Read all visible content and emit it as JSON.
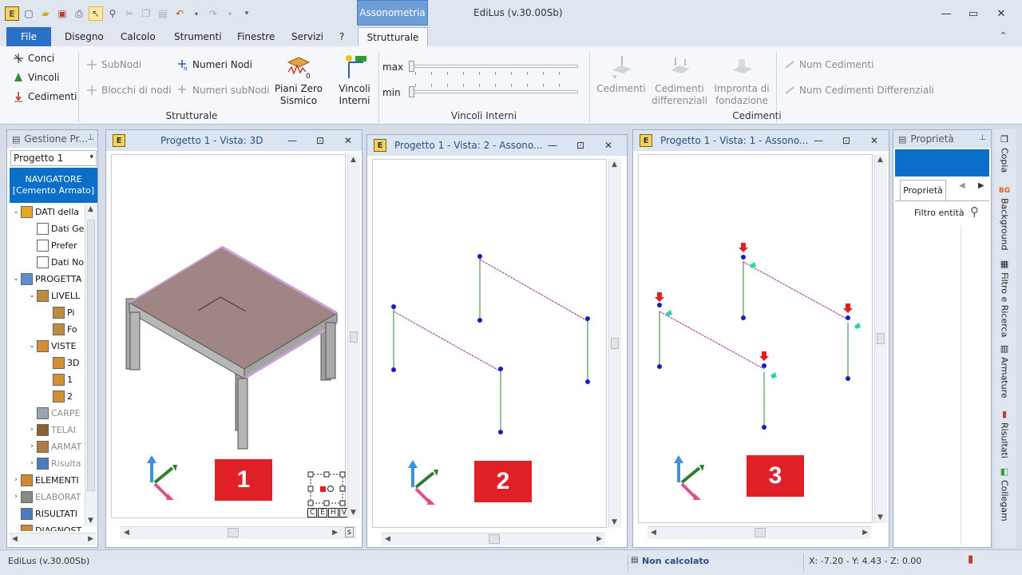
{
  "app": {
    "title": "EdiLus (v.30.00Sb)",
    "context_tab": "Assonometria"
  },
  "menu": {
    "file": "File",
    "tabs": [
      "Disegno",
      "Calcolo",
      "Strumenti",
      "Finestre",
      "Servizi",
      "?"
    ],
    "active_tab": "Strutturale"
  },
  "ribbon": {
    "strutturale": {
      "conci": "Conci",
      "vincoli": "Vincoli",
      "cedimenti": "Cedimenti",
      "subnodi": "SubNodi",
      "blocchi": "Blocchi di nodi",
      "numeri_nodi": "Numeri Nodi",
      "numeri_subnodi": "Numeri subNodi",
      "piani_zero": "Piani Zero Sismico",
      "group": "Strutturale"
    },
    "vincoli_interni": {
      "max": "max",
      "min": "min",
      "button": "Vincoli Interni",
      "group": "Vincoli Interni",
      "max_level": 0,
      "min_level": 0
    },
    "cedimenti": {
      "cedimenti": "Cedimenti",
      "differenziali": "Cedimenti differenziali",
      "impronta": "Impronta di fondazione",
      "num_ced": "Num Cedimenti",
      "num_ced_diff": "Num Cedimenti Differenziali",
      "group": "Cedimenti"
    }
  },
  "left_panel": {
    "title": "Gestione Pr...",
    "dropdown": "Progetto 1",
    "navigator_line1": "NAVIGATORE",
    "navigator_line2": "[Cemento Armato]",
    "tree": [
      {
        "label": "DATI della",
        "exp": "v",
        "indent": 0,
        "icon": "folder-icon",
        "dis": false
      },
      {
        "label": "Dati Ge",
        "exp": "",
        "indent": 1,
        "icon": "doc-icon",
        "dis": false
      },
      {
        "label": "Prefer",
        "exp": "",
        "indent": 1,
        "icon": "doc-icon",
        "dis": false
      },
      {
        "label": "Dati No",
        "exp": "",
        "indent": 1,
        "icon": "doc-icon",
        "dis": false
      },
      {
        "label": "PROGETTA",
        "exp": "v",
        "indent": 0,
        "icon": "project-icon",
        "dis": false
      },
      {
        "label": "LIVELL",
        "exp": "v",
        "indent": 1,
        "icon": "levels-icon",
        "dis": false
      },
      {
        "label": "Pi",
        "exp": "",
        "indent": 2,
        "icon": "level-icon",
        "dis": false
      },
      {
        "label": "Fo",
        "exp": "",
        "indent": 2,
        "icon": "level-icon",
        "dis": false
      },
      {
        "label": "VISTE",
        "exp": "v",
        "indent": 1,
        "icon": "3d-icon",
        "dis": false
      },
      {
        "label": "3D",
        "exp": "",
        "indent": 2,
        "icon": "3d-icon",
        "dis": false
      },
      {
        "label": "1",
        "exp": "",
        "indent": 2,
        "icon": "3d-icon",
        "dis": false
      },
      {
        "label": "2",
        "exp": "",
        "indent": 2,
        "icon": "3d-icon",
        "dis": false
      },
      {
        "label": "CARPE",
        "exp": "",
        "indent": 1,
        "icon": "carp-icon",
        "dis": true
      },
      {
        "label": "TELAI",
        "exp": ">",
        "indent": 1,
        "icon": "frame-icon",
        "dis": true
      },
      {
        "label": "ARMAT",
        "exp": ">",
        "indent": 1,
        "icon": "rebar-icon",
        "dis": true
      },
      {
        "label": "Risulta",
        "exp": ">",
        "indent": 1,
        "icon": "results-icon",
        "dis": true
      },
      {
        "label": "ELEMENTI",
        "exp": ">",
        "indent": 0,
        "icon": "elements-icon",
        "dis": false
      },
      {
        "label": "ELABORAT",
        "exp": ">",
        "indent": 0,
        "icon": "docs-icon",
        "dis": true
      },
      {
        "label": "RISULTATI",
        "exp": "",
        "indent": 0,
        "icon": "results-icon",
        "dis": false
      },
      {
        "label": "DIAGNOST",
        "exp": "",
        "indent": 0,
        "icon": "diag-icon",
        "dis": false
      }
    ]
  },
  "views": [
    {
      "title": "Progetto 1  -  Vista: 3D",
      "badge": "1",
      "cehv": [
        "C",
        "E",
        "H",
        "V"
      ],
      "scroll_s": "s"
    },
    {
      "title": "Progetto 1  -  Vista: 2 - Assono...",
      "badge": "2"
    },
    {
      "title": "Progetto 1  -  Vista: 1 - Assono...",
      "badge": "3"
    }
  ],
  "properties": {
    "title": "Proprietà",
    "tab": "Proprietà",
    "filter": "Filtro entità"
  },
  "side_tabs": [
    "Copia",
    "Background",
    "Filtro e Ricerca",
    "Armature",
    "Risultati",
    "Collegam"
  ],
  "status": {
    "left": "EdiLus (v.30.00Sb)",
    "state": "Non calcolato",
    "coords": "X: -7.20 - Y: 4.43 - Z: 0.00"
  }
}
